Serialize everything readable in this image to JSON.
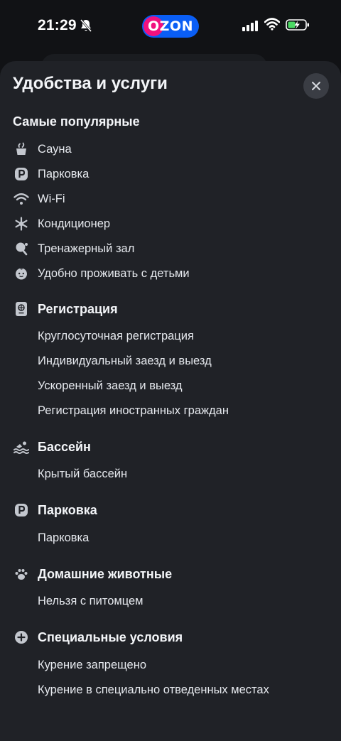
{
  "status_bar": {
    "time": "21:29",
    "logo_text": "OZON",
    "icons": [
      "bell-slash-icon",
      "cellular-signal-icon",
      "wifi-icon",
      "battery-charging-icon"
    ]
  },
  "sheet": {
    "title": "Удобства и услуги",
    "close_icon": "close-icon"
  },
  "popular": {
    "heading": "Самые популярные",
    "items": [
      {
        "label": "Сауна",
        "icon": "sauna-icon"
      },
      {
        "label": "Парковка",
        "icon": "parking-icon"
      },
      {
        "label": "Wi-Fi",
        "icon": "wifi-icon"
      },
      {
        "label": "Кондиционер",
        "icon": "snowflake-icon"
      },
      {
        "label": "Тренажерный зал",
        "icon": "gym-icon"
      },
      {
        "label": "Удобно проживать с детьми",
        "icon": "baby-icon"
      }
    ]
  },
  "categories": [
    {
      "title": "Регистрация",
      "icon": "passport-icon",
      "items": [
        "Круглосуточная регистрация",
        "Индивидуальный заезд и выезд",
        "Ускоренный заезд и выезд",
        "Регистрация иностранных граждан"
      ]
    },
    {
      "title": "Бассейн",
      "icon": "swimming-icon",
      "items": [
        "Крытый бассейн"
      ]
    },
    {
      "title": "Парковка",
      "icon": "parking-icon",
      "items": [
        "Парковка"
      ]
    },
    {
      "title": "Домашние животные",
      "icon": "paw-icon",
      "items": [
        "Нельзя с питомцем"
      ]
    },
    {
      "title": "Специальные условия",
      "icon": "plus-circle-icon",
      "items": [
        "Курение запрещено",
        "Курение в специально отведенных местах"
      ]
    }
  ],
  "colors": {
    "background": "#111215",
    "sheet": "#202227",
    "text": "#e6e9ee",
    "icon": "#c3c7ce",
    "ozon_blue": "#0a5ef5",
    "ozon_pink": "#f1117e",
    "battery_green": "#4cd964"
  }
}
